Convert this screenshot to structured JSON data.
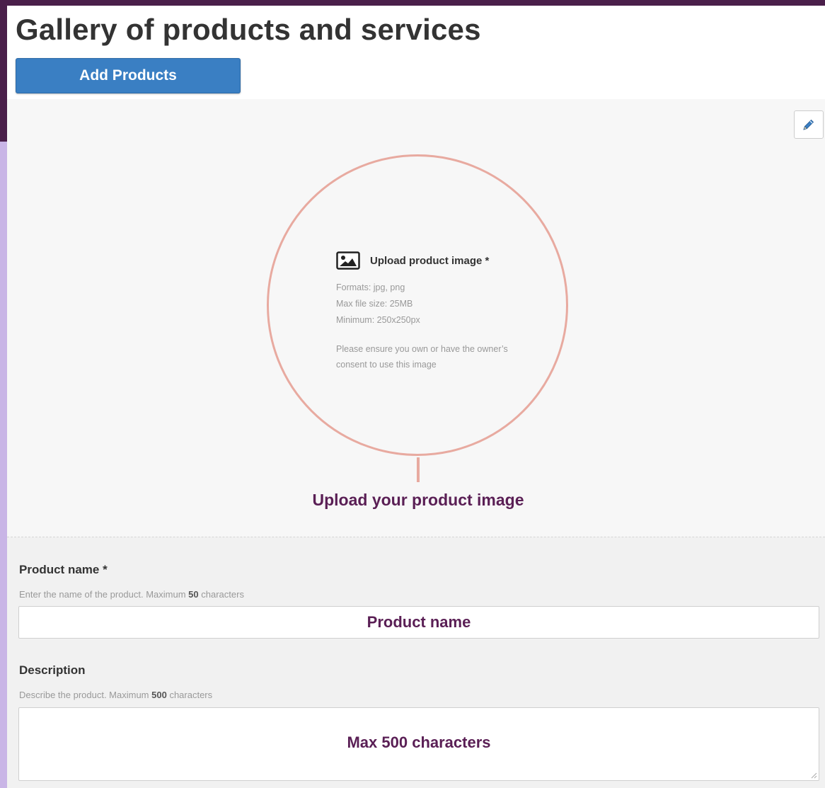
{
  "page": {
    "title": "Gallery of products and services",
    "add_button_label": "Add Products"
  },
  "upload": {
    "title": "Upload product image *",
    "formats": "Formats: jpg, png",
    "max_size": "Max file size: 25MB",
    "minimum": "Minimum: 250x250px",
    "note": "Please ensure you own or have the owner’s consent to use this image",
    "edit_icon": "pencil-icon",
    "image_icon": "image-icon",
    "callout_label": "Upload your product image"
  },
  "form": {
    "product_name": {
      "label": "Product name *",
      "hint_before": "Enter the name of the product. Maximum ",
      "hint_bold": "50",
      "hint_after": " characters",
      "overlay": "Product name"
    },
    "description": {
      "label": "Description",
      "hint_before": "Describe the product. Maximum ",
      "hint_bold": "500",
      "hint_after": " characters",
      "overlay": "Max 500 characters"
    }
  },
  "colors": {
    "header_bg": "#4a1f4a",
    "accent_strip": "#c9b5e6",
    "button_blue": "#3a7fc3",
    "callout": "#e8aaa0",
    "annotation_text": "#5a1f55"
  }
}
